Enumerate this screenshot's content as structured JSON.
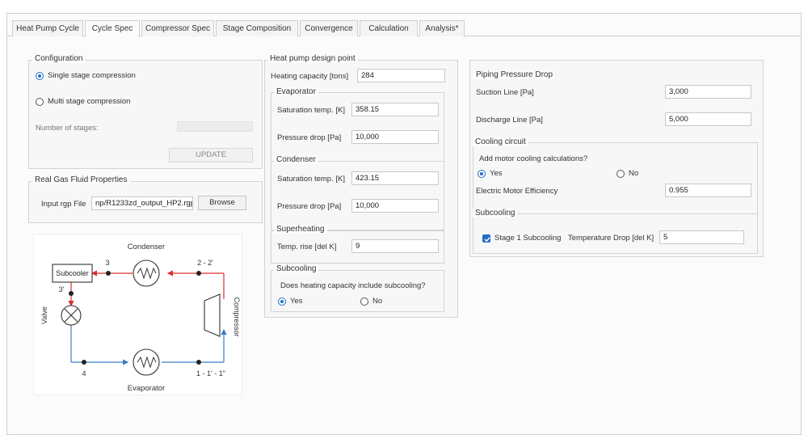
{
  "tabs": [
    {
      "label": "Heat Pump Cycle",
      "active": false
    },
    {
      "label": "Cycle Spec",
      "active": true
    },
    {
      "label": "Compressor Spec",
      "active": false
    },
    {
      "label": "Stage Composition",
      "active": false
    },
    {
      "label": "Convergence",
      "active": false
    },
    {
      "label": "Calculation",
      "active": false
    },
    {
      "label": "Analysis*",
      "active": false
    }
  ],
  "configuration": {
    "title": "Configuration",
    "single_stage_label": "Single stage compression",
    "multi_stage_label": "Multi stage compression",
    "selected": "single",
    "number_of_stages_label": "Number of stages:",
    "number_of_stages_value": "",
    "update_label": "UPDATE"
  },
  "rgp": {
    "title": "Real Gas Fluid Properties",
    "input_label": "Input rgp File",
    "input_value": "np/R1233zd_output_HP2.rgp",
    "browse_label": "Browse"
  },
  "design_point": {
    "title": "Heat pump design point",
    "heating_capacity_label": "Heating capacity [tons]",
    "heating_capacity_value": "284",
    "evaporator": {
      "title": "Evaporator",
      "sat_temp_label": "Saturation temp. [K]",
      "sat_temp_value": "358.15",
      "pressure_drop_label": "Pressure drop [Pa]",
      "pressure_drop_value": "10,000"
    },
    "condenser": {
      "title": "Condenser",
      "sat_temp_label": "Saturation temp. [K]",
      "sat_temp_value": "423.15",
      "pressure_drop_label": "Pressure drop [Pa]",
      "pressure_drop_value": "10,000"
    },
    "superheating": {
      "title": "Superheating",
      "temp_rise_label": "Temp. rise [del K]",
      "temp_rise_value": "9"
    },
    "subcooling": {
      "title": "Subcooling",
      "question": "Does heating capacity include subcooling?",
      "yes_label": "Yes",
      "no_label": "No",
      "selected": "yes"
    }
  },
  "piping": {
    "title": "Piping Pressure Drop",
    "suction_label": "Suction Line [Pa]",
    "suction_value": "3,000",
    "discharge_label": "Discharge Line [Pa]",
    "discharge_value": "5,000"
  },
  "cooling": {
    "title": "Cooling circuit",
    "question": "Add motor cooling calculations?",
    "yes_label": "Yes",
    "no_label": "No",
    "selected": "yes",
    "efficiency_label": "Electric Motor Efficiency",
    "efficiency_value": "0.955"
  },
  "subcooling_right": {
    "title": "Subcooling",
    "stage1_label": "Stage 1 Subcooling",
    "stage1_checked": true,
    "temp_drop_label": "Temperature Drop [del K]",
    "temp_drop_value": "5"
  },
  "diagram": {
    "condenser_label": "Condenser",
    "evaporator_label": "Evaporator",
    "subcooler_label": "Subcooler",
    "valve_label": "Valve",
    "compressor_label": "Compressor",
    "point_3": "3",
    "point_3p": "3'",
    "point_22": "2 - 2'",
    "point_4": "4",
    "point_1": "1 - 1' - 1\"",
    "hot_line_color": "#d9302c",
    "cold_line_color": "#3b7dc4"
  },
  "colors": {
    "accent": "#1f6fc5"
  }
}
